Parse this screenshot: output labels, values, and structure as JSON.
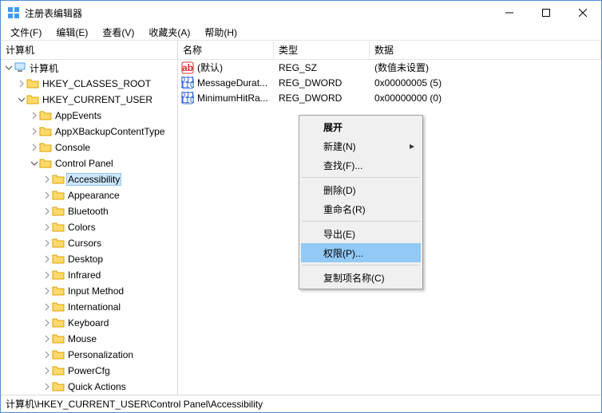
{
  "window": {
    "title": "注册表编辑器"
  },
  "menus": {
    "file": "文件(F)",
    "edit": "编辑(E)",
    "view": "查看(V)",
    "favorites": "收藏夹(A)",
    "help": "帮助(H)"
  },
  "tree_header": {
    "label": "计算机"
  },
  "tree": {
    "root": "计算机",
    "roots": [
      {
        "name": "HKEY_CLASSES_ROOT",
        "expanded": false
      },
      {
        "name": "HKEY_CURRENT_USER",
        "expanded": true,
        "children": [
          {
            "name": "AppEvents"
          },
          {
            "name": "AppXBackupContentType"
          },
          {
            "name": "Console"
          },
          {
            "name": "Control Panel",
            "expanded": true,
            "children": [
              {
                "name": "Accessibility",
                "selected": true
              },
              {
                "name": "Appearance"
              },
              {
                "name": "Bluetooth"
              },
              {
                "name": "Colors"
              },
              {
                "name": "Cursors"
              },
              {
                "name": "Desktop"
              },
              {
                "name": "Infrared"
              },
              {
                "name": "Input Method"
              },
              {
                "name": "International"
              },
              {
                "name": "Keyboard"
              },
              {
                "name": "Mouse"
              },
              {
                "name": "Personalization"
              },
              {
                "name": "PowerCfg"
              },
              {
                "name": "Quick Actions"
              }
            ]
          }
        ]
      }
    ]
  },
  "list_header": {
    "name": "名称",
    "type": "类型",
    "data": "数据"
  },
  "list_rows": [
    {
      "icon": "sz",
      "name": "(默认)",
      "type": "REG_SZ",
      "data": "(数值未设置)"
    },
    {
      "icon": "bin",
      "name": "MessageDurat...",
      "type": "REG_DWORD",
      "data": "0x00000005 (5)"
    },
    {
      "icon": "bin",
      "name": "MinimumHitRa...",
      "type": "REG_DWORD",
      "data": "0x00000000 (0)"
    }
  ],
  "context_menu": {
    "expand": "展开",
    "new": "新建(N)",
    "find": "查找(F)...",
    "delete": "删除(D)",
    "rename": "重命名(R)",
    "export": "导出(E)",
    "permissions": "权限(P)...",
    "copy_key_name": "复制项名称(C)"
  },
  "status": {
    "path": "计算机\\HKEY_CURRENT_USER\\Control Panel\\Accessibility"
  }
}
